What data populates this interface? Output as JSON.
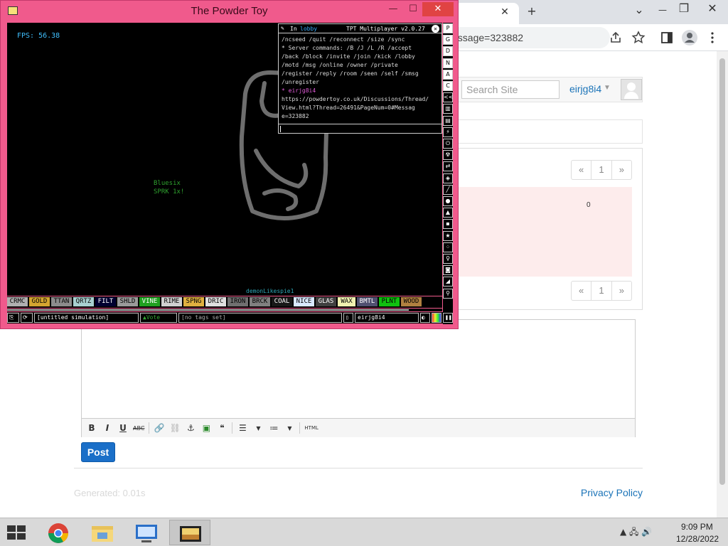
{
  "browser": {
    "url_fragment": "essage=323882",
    "tab_close": "✕",
    "new_tab": "+",
    "window_controls": {
      "chevron": "⌄",
      "minimize": "—",
      "restore": "❐",
      "close": "✕"
    },
    "toolbar_icons": [
      "share-icon",
      "star-icon",
      "sidebar-icon",
      "profile-icon",
      "menu-icon"
    ]
  },
  "site": {
    "search_placeholder": "Search Site",
    "username": "eirjg8i4",
    "pager": {
      "prev": "«",
      "page": "1",
      "next": "»"
    },
    "post_count": "0",
    "editor_toolbar": {
      "bold": "B",
      "italic": "I",
      "underline": "U",
      "strike": "ABC",
      "link": "🔗",
      "unlink": "⛓",
      "anchor": "⚓",
      "image": "▣",
      "quote": "❝",
      "bullets": "☰",
      "numbered": "≔",
      "html": "HTML"
    },
    "post_button": "Post",
    "generated": "Generated: 0.01s",
    "privacy": "Privacy Policy"
  },
  "tpt": {
    "title": "The Powder Toy",
    "window_controls": {
      "minimize": "—",
      "maximize": "☐",
      "close": "✕"
    },
    "fps": "FPS: 56.38",
    "hover_name": "Bluesix",
    "hover_element": "SPRK 1x!",
    "cursor_user": "demonLikespie1",
    "chat": {
      "in_label": "In",
      "room": "lobby",
      "version": "TPT Multiplayer v2.0.27",
      "lines": [
        {
          "text": "/ncseed /quit /reconnect /size /sync",
          "kind": "text"
        },
        {
          "text": "* Server commands: /B /J /L /R /accept",
          "kind": "text"
        },
        {
          "text": "/back /block /invite /join /kick /lobby",
          "kind": "text"
        },
        {
          "text": "/motd /msg /online /owner /private",
          "kind": "text"
        },
        {
          "text": "/register /reply /room /seen /self /smsg",
          "kind": "text"
        },
        {
          "text": "/unregister",
          "kind": "text"
        },
        {
          "text": "* eirjg8i4",
          "kind": "user"
        },
        {
          "text": "https://powdertoy.co.uk/Discussions/Thread/",
          "kind": "text"
        },
        {
          "text": "View.html?Thread=26491&PageNum=0#Messag",
          "kind": "text"
        },
        {
          "text": "e=323882",
          "kind": "text"
        }
      ]
    },
    "sidebar": [
      "P",
      "G",
      "D",
      "N",
      "A",
      "C",
      "<<",
      "▥",
      "▤",
      "⚡",
      "⏻",
      "☢",
      "⇄",
      "◈",
      "╱",
      "●",
      "▲",
      "▪",
      "★",
      "⁘",
      "♀",
      "◙",
      "◢",
      "⚲"
    ],
    "elements": [
      {
        "label": "CRMC",
        "bg": "#b0b0b0",
        "fg": "#000"
      },
      {
        "label": "GOLD",
        "bg": "#d4a530",
        "fg": "#000"
      },
      {
        "label": "TTAN",
        "bg": "#8c8c8c",
        "fg": "#000"
      },
      {
        "label": "QRTZ",
        "bg": "#a8d0d0",
        "fg": "#000"
      },
      {
        "label": "FILT",
        "bg": "#000030",
        "fg": "#fff"
      },
      {
        "label": "SHLD",
        "bg": "#9a9a9a",
        "fg": "#000"
      },
      {
        "label": "VINE",
        "bg": "#20a020",
        "fg": "#fff"
      },
      {
        "label": "RIME",
        "bg": "#d0d0d0",
        "fg": "#000"
      },
      {
        "label": "SPNG",
        "bg": "#e0b040",
        "fg": "#000"
      },
      {
        "label": "DRIC",
        "bg": "#e0e0e0",
        "fg": "#000"
      },
      {
        "label": "IRON",
        "bg": "#707070",
        "fg": "#000"
      },
      {
        "label": "BRCK",
        "bg": "#808080",
        "fg": "#000"
      },
      {
        "label": "COAL",
        "bg": "#181818",
        "fg": "#fff"
      },
      {
        "label": "NICE",
        "bg": "#d8e8ff",
        "fg": "#000"
      },
      {
        "label": "GLAS",
        "bg": "#404040",
        "fg": "#fff"
      },
      {
        "label": "WAX",
        "bg": "#f0f0b0",
        "fg": "#000"
      },
      {
        "label": "BMTL",
        "bg": "#505070",
        "fg": "#fff"
      },
      {
        "label": "PLNT",
        "bg": "#10c010",
        "fg": "#000"
      },
      {
        "label": "WOOD",
        "bg": "#b08040",
        "fg": "#000"
      }
    ],
    "bottom": {
      "save_name": "[untitled simulation]",
      "vote": "Vote",
      "tags": "[no tags set]",
      "user": "eirjg8i4"
    }
  },
  "taskbar": {
    "apps": [
      "chrome-icon",
      "file-explorer-icon",
      "remote-desktop-icon",
      "powder-toy-icon"
    ],
    "tray": "▲  🖧  🔊",
    "time": "9:09 PM",
    "date": "12/28/2022"
  }
}
